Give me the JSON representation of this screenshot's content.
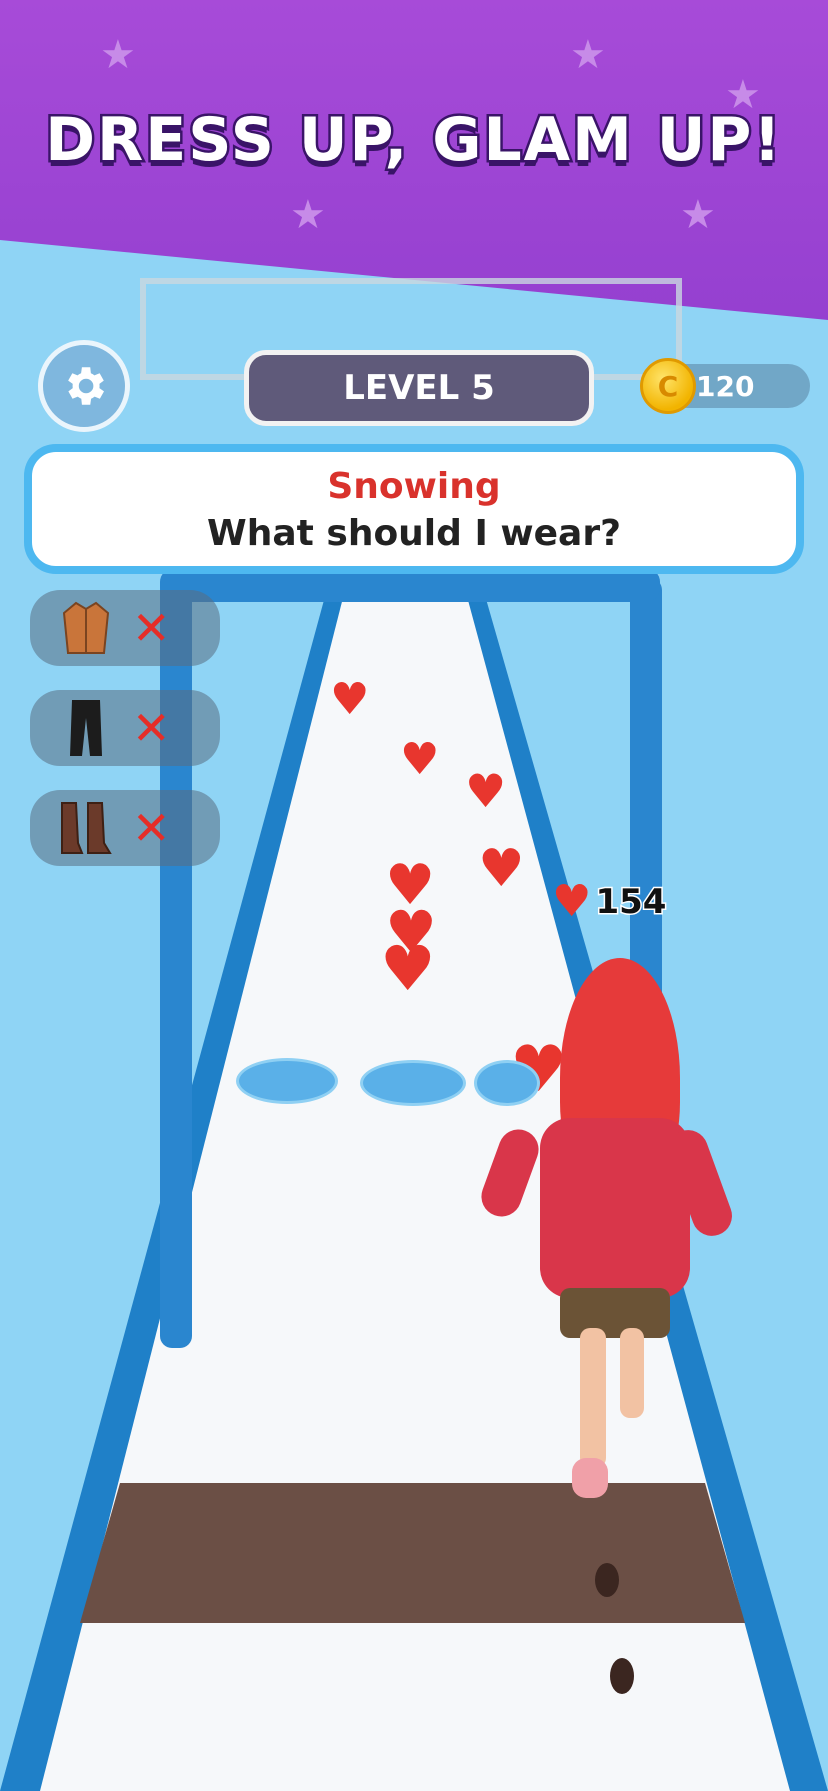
{
  "banner": {
    "title": "DRESS UP, GLAM UP!"
  },
  "hud": {
    "settings_icon": "gear-icon",
    "level_label": "LEVEL 5",
    "coins": "120",
    "coin_icon": "coin-icon"
  },
  "prompt": {
    "weather": "Snowing",
    "question": "What should I wear?"
  },
  "outfit_slots": [
    {
      "item": "coat",
      "icon": "coat-icon",
      "status_icon": "x-mark-icon",
      "status": "✕"
    },
    {
      "item": "pants",
      "icon": "pants-icon",
      "status_icon": "x-mark-icon",
      "status": "✕"
    },
    {
      "item": "boots",
      "icon": "boots-icon",
      "status_icon": "x-mark-icon",
      "status": "✕"
    }
  ],
  "score": {
    "value": "154",
    "icon": "heart-icon"
  },
  "colors": {
    "banner_purple": "#9f46d6",
    "sky_blue": "#8fd4f5",
    "track_blue": "#1f80c8",
    "heart_red": "#e8362e",
    "prompt_border": "#4db8f0"
  }
}
